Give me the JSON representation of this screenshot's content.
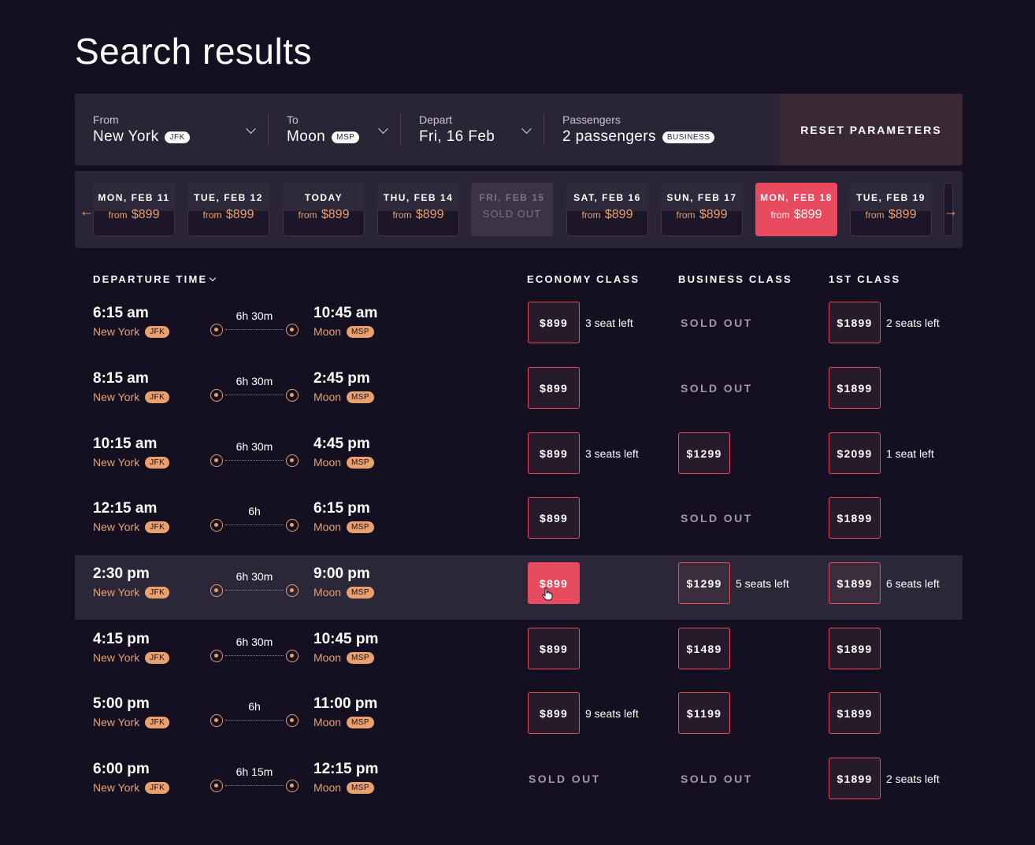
{
  "page": {
    "title": "Search results"
  },
  "search": {
    "from": {
      "label": "From",
      "value": "New York",
      "code": "JFK"
    },
    "to": {
      "label": "To",
      "value": "Moon",
      "code": "MSP"
    },
    "depart": {
      "label": "Depart",
      "value": "Fri, 16 Feb"
    },
    "passengers": {
      "label": "Passengers",
      "value": "2 passengers",
      "class_badge": "BUSINESS"
    },
    "reset_label": "RESET PARAMETERS"
  },
  "dates": [
    {
      "day": "MON, FEB 11",
      "from": "from",
      "price": "$899",
      "state": "normal"
    },
    {
      "day": "TUE, FEB 12",
      "from": "from",
      "price": "$899",
      "state": "normal"
    },
    {
      "day": "TODAY",
      "from": "from",
      "price": "$899",
      "state": "normal"
    },
    {
      "day": "THU, FEB 14",
      "from": "from",
      "price": "$899",
      "state": "normal"
    },
    {
      "day": "FRI, FEB 15",
      "sold": "SOLD OUT",
      "state": "soldout"
    },
    {
      "day": "SAT, FEB 16",
      "from": "from",
      "price": "$899",
      "state": "normal"
    },
    {
      "day": "SUN, FEB 17",
      "from": "from",
      "price": "$899",
      "state": "normal"
    },
    {
      "day": "MON, FEB 18",
      "from": "from",
      "price": "$899",
      "state": "active"
    },
    {
      "day": "TUE, FEB 19",
      "from": "from",
      "price": "$899",
      "state": "normal"
    }
  ],
  "columns": {
    "departure": "DEPARTURE TIME",
    "economy": "ECONOMY CLASS",
    "business": "BUSINESS CLASS",
    "first": "1ST CLASS"
  },
  "flights": [
    {
      "dep_time": "6:15 am",
      "dep_city": "New York",
      "dep_code": "JFK",
      "duration": "6h 30m",
      "arr_time": "10:45 am",
      "arr_city": "Moon",
      "arr_code": "MSP",
      "economy": {
        "price": "$899",
        "seats": "3 seat left"
      },
      "business": {
        "sold": "SOLD OUT"
      },
      "first": {
        "price": "$1899",
        "seats": "2 seats left"
      }
    },
    {
      "dep_time": "8:15 am",
      "dep_city": "New York",
      "dep_code": "JFK",
      "duration": "6h 30m",
      "arr_time": "2:45 pm",
      "arr_city": "Moon",
      "arr_code": "MSP",
      "economy": {
        "price": "$899"
      },
      "business": {
        "sold": "SOLD OUT"
      },
      "first": {
        "price": "$1899"
      }
    },
    {
      "dep_time": "10:15 am",
      "dep_city": "New York",
      "dep_code": "JFK",
      "duration": "6h 30m",
      "arr_time": "4:45 pm",
      "arr_city": "Moon",
      "arr_code": "MSP",
      "economy": {
        "price": "$899",
        "seats": "3 seats left"
      },
      "business": {
        "price": "$1299"
      },
      "first": {
        "price": "$2099",
        "seats": "1 seat left"
      }
    },
    {
      "dep_time": "12:15 am",
      "dep_city": "New York",
      "dep_code": "JFK",
      "duration": "6h",
      "arr_time": "6:15 pm",
      "arr_city": "Moon",
      "arr_code": "MSP",
      "economy": {
        "price": "$899"
      },
      "business": {
        "sold": "SOLD OUT"
      },
      "first": {
        "price": "$1899"
      }
    },
    {
      "dep_time": "2:30 pm",
      "dep_city": "New York",
      "dep_code": "JFK",
      "duration": "6h 30m",
      "arr_time": "9:00 pm",
      "arr_city": "Moon",
      "arr_code": "MSP",
      "economy": {
        "price": "$899",
        "selected": true
      },
      "business": {
        "price": "$1299",
        "seats": "5 seats left"
      },
      "first": {
        "price": "$1899",
        "seats": "6 seats left"
      }
    },
    {
      "dep_time": "4:15 pm",
      "dep_city": "New York",
      "dep_code": "JFK",
      "duration": "6h 30m",
      "arr_time": "10:45 pm",
      "arr_city": "Moon",
      "arr_code": "MSP",
      "economy": {
        "price": "$899"
      },
      "business": {
        "price": "$1489"
      },
      "first": {
        "price": "$1899"
      }
    },
    {
      "dep_time": "5:00 pm",
      "dep_city": "New York",
      "dep_code": "JFK",
      "duration": "6h",
      "arr_time": "11:00 pm",
      "arr_city": "Moon",
      "arr_code": "MSP",
      "economy": {
        "price": "$899",
        "seats": "9 seats left"
      },
      "business": {
        "price": "$1199"
      },
      "first": {
        "price": "$1899"
      }
    },
    {
      "dep_time": "6:00 pm",
      "dep_city": "New York",
      "dep_code": "JFK",
      "duration": "6h 15m",
      "arr_time": "12:15 pm",
      "arr_city": "Moon",
      "arr_code": "MSP",
      "economy": {
        "sold": "SOLD OUT"
      },
      "business": {
        "sold": "SOLD OUT"
      },
      "first": {
        "price": "$1899",
        "seats": "2 seats left"
      }
    }
  ],
  "colors": {
    "accent": "#e84a5f",
    "orange": "#e8a06f",
    "background": "#151021",
    "panel": "#2a2437"
  },
  "icons": [
    "chevron-down-icon",
    "arrow-left-icon",
    "arrow-right-icon",
    "hand-cursor-icon",
    "origin-dot-icon",
    "destination-dot-icon"
  ]
}
